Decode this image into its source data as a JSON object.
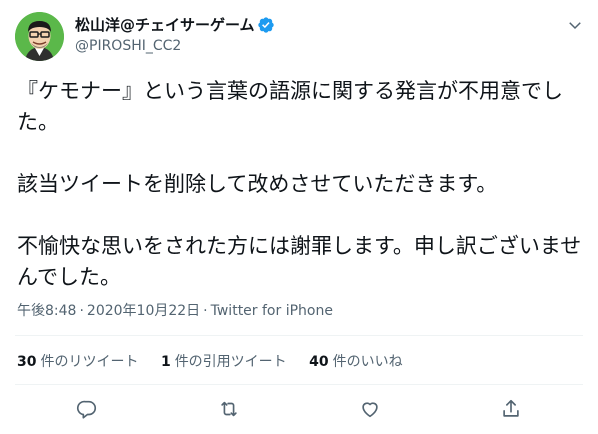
{
  "user": {
    "display_name": "松山洋@チェイサーゲーム",
    "handle": "@PIROSHI_CC2",
    "verified": true
  },
  "tweet": {
    "paragraphs": [
      "『ケモナー』という言葉の語源に関する発言が不用意でした。",
      "該当ツイートを削除して改めさせていただきます。",
      "不愉快な思いをされた方には謝罪します。申し訳ございませんでした。"
    ],
    "time": "午後8:48",
    "separator": "·",
    "date": "2020年10月22日",
    "source": "Twitter for iPhone"
  },
  "stats": {
    "retweets": {
      "count": "30",
      "label": "件のリツイート"
    },
    "quotes": {
      "count": "1",
      "label": "件の引用ツイート"
    },
    "likes": {
      "count": "40",
      "label": "件のいいね"
    }
  },
  "icons": {
    "verified": "verified-badge-icon",
    "caret": "chevron-down-icon",
    "reply": "reply-icon",
    "retweet": "retweet-icon",
    "like": "heart-icon",
    "share": "share-icon"
  },
  "colors": {
    "accent": "#1d9bf0",
    "text": "#0f1419",
    "muted": "#536471",
    "divider": "#eff3f4",
    "icon": "#536471"
  }
}
